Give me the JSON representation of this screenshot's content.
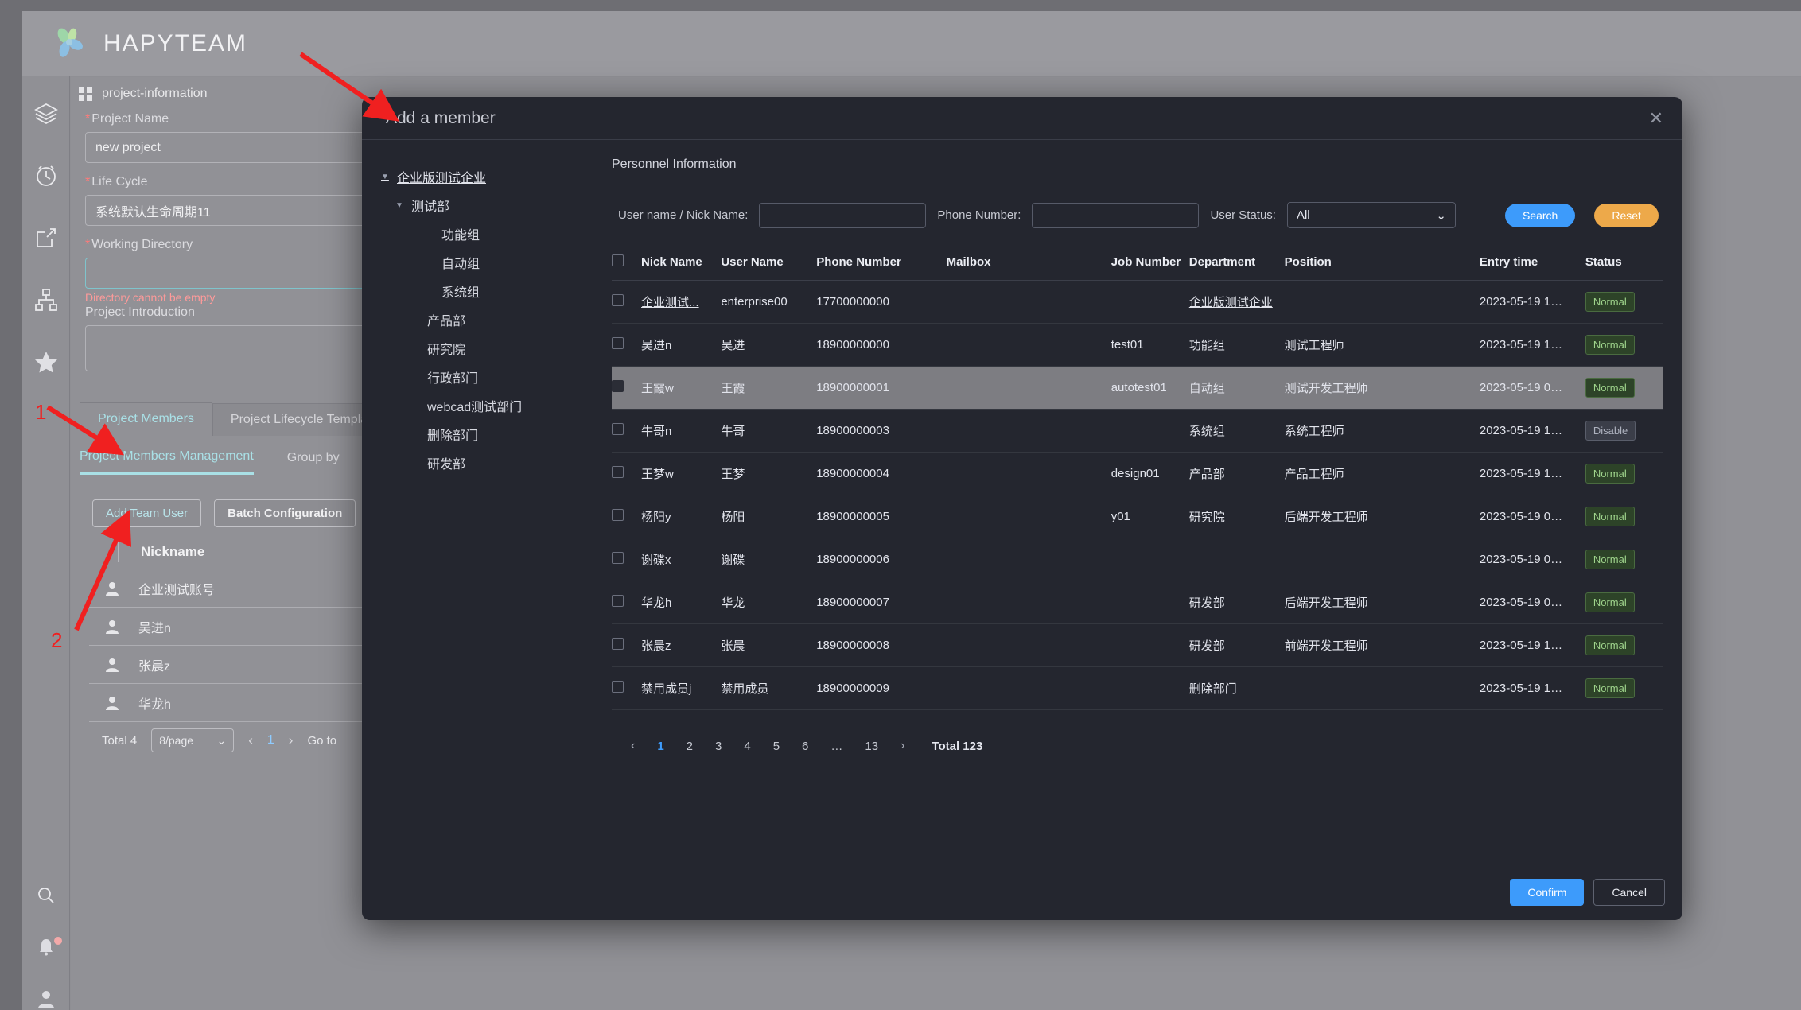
{
  "brand": {
    "title": "HAPYTEAM",
    "logo_icon": "flower-logo-icon"
  },
  "rail": {
    "items": [
      {
        "icon": "layers-icon",
        "name": "rail-item-layers"
      },
      {
        "icon": "clock-icon",
        "name": "rail-item-clock"
      },
      {
        "icon": "share-icon",
        "name": "rail-item-share"
      },
      {
        "icon": "org-chart-icon",
        "name": "rail-item-org"
      },
      {
        "icon": "star-icon",
        "name": "rail-item-star"
      }
    ],
    "bottom": [
      {
        "icon": "search-icon",
        "name": "rail-item-search"
      },
      {
        "icon": "bell-icon",
        "name": "rail-item-notifications"
      },
      {
        "icon": "user-icon",
        "name": "rail-item-account"
      }
    ]
  },
  "breadcrumb": {
    "icon": "grid-icon",
    "text": "project-information"
  },
  "form": {
    "project_name": {
      "label": "Project Name",
      "required": "*",
      "value": "new project"
    },
    "life_cycle": {
      "label": "Life Cycle",
      "required": "*",
      "value": "系统默认生命周期11"
    },
    "working_directory": {
      "label": "Working Directory",
      "required": "*",
      "value": "",
      "error": "Directory cannot be empty"
    },
    "project_introduction": {
      "label": "Project Introduction",
      "value": ""
    }
  },
  "tabs": [
    {
      "label": "Project Members",
      "active": true
    },
    {
      "label": "Project Lifecycle Template Settin",
      "active": false
    }
  ],
  "subtabs": [
    {
      "label": "Project Members Management",
      "active": true
    },
    {
      "label": "Group by",
      "active": false
    }
  ],
  "actions": {
    "add_team_user": "Add Team User",
    "batch_configuration": "Batch Configuration"
  },
  "members_table": {
    "header": "Nickname",
    "rows": [
      {
        "name": "企业测试账号"
      },
      {
        "name": "吴进n"
      },
      {
        "name": "张晨z"
      },
      {
        "name": "华龙h"
      }
    ],
    "pager": {
      "total": "Total 4",
      "page_size": "8/page",
      "prev": "‹",
      "current": "1",
      "next": "›",
      "goto": "Go to"
    }
  },
  "modal": {
    "title": "Add a member",
    "close_icon": "close-icon",
    "tree": [
      {
        "label": "企业版测试企业",
        "level": 0,
        "caret": "▼",
        "underline": true
      },
      {
        "label": "测试部",
        "level": 1,
        "caret": "▼",
        "underline": false
      },
      {
        "label": "功能组",
        "level": 2,
        "caret": "",
        "underline": false
      },
      {
        "label": "自动组",
        "level": 2,
        "caret": "",
        "underline": false
      },
      {
        "label": "系统组",
        "level": 2,
        "caret": "",
        "underline": false
      },
      {
        "label": "产品部",
        "level": 1,
        "caret": "",
        "underline": false
      },
      {
        "label": "研究院",
        "level": 1,
        "caret": "",
        "underline": false
      },
      {
        "label": "行政部门",
        "level": 1,
        "caret": "",
        "underline": false
      },
      {
        "label": "webcad测试部门",
        "level": 1,
        "caret": "",
        "underline": false
      },
      {
        "label": "删除部门",
        "level": 1,
        "caret": "",
        "underline": false
      },
      {
        "label": "研发部",
        "level": 1,
        "caret": "",
        "underline": false
      }
    ],
    "panel_title": "Personnel Information",
    "filters": {
      "username_label": "User name / Nick Name:",
      "username_value": "",
      "phone_label": "Phone Number:",
      "phone_value": "",
      "status_label": "User Status:",
      "status_value": "All",
      "chevron_icon": "chevron-down-icon",
      "search_button": "Search",
      "reset_button": "Reset"
    },
    "table": {
      "columns": [
        "",
        "Nick Name",
        "User Name",
        "Phone Number",
        "Mailbox",
        "Job Number",
        "Department",
        "Position",
        "Entry time",
        "Status"
      ],
      "rows": [
        {
          "checked": false,
          "selected": false,
          "nick": "企业测试...",
          "nick_link": true,
          "user": "enterprise00",
          "phone": "17700000000",
          "mailbox": "",
          "job": "",
          "dept": "企业版测试企业",
          "dept_link": true,
          "position": "",
          "entry": "2023-05-19 1…",
          "status": "Normal",
          "status_kind": "normal"
        },
        {
          "checked": false,
          "selected": false,
          "nick": "吴进n",
          "nick_link": false,
          "user": "吴进",
          "phone": "18900000000",
          "mailbox": "",
          "job": "test01",
          "dept": "功能组",
          "dept_link": false,
          "position": "测试工程师",
          "entry": "2023-05-19 1…",
          "status": "Normal",
          "status_kind": "normal"
        },
        {
          "checked": true,
          "selected": true,
          "nick": "王霞w",
          "nick_link": false,
          "user": "王霞",
          "phone": "18900000001",
          "mailbox": "",
          "job": "autotest01",
          "dept": "自动组",
          "dept_link": false,
          "position": "测试开发工程师",
          "entry": "2023-05-19 0…",
          "status": "Normal",
          "status_kind": "normal"
        },
        {
          "checked": false,
          "selected": false,
          "nick": "牛哥n",
          "nick_link": false,
          "user": "牛哥",
          "phone": "18900000003",
          "mailbox": "",
          "job": "",
          "dept": "系统组",
          "dept_link": false,
          "position": "系统工程师",
          "entry": "2023-05-19 1…",
          "status": "Disable",
          "status_kind": "disable"
        },
        {
          "checked": false,
          "selected": false,
          "nick": "王梦w",
          "nick_link": false,
          "user": "王梦",
          "phone": "18900000004",
          "mailbox": "",
          "job": "design01",
          "dept": "产品部",
          "dept_link": false,
          "position": "产品工程师",
          "entry": "2023-05-19 1…",
          "status": "Normal",
          "status_kind": "normal"
        },
        {
          "checked": false,
          "selected": false,
          "nick": "杨阳y",
          "nick_link": false,
          "user": "杨阳",
          "phone": "18900000005",
          "mailbox": "",
          "job": "y01",
          "dept": "研究院",
          "dept_link": false,
          "position": "后端开发工程师",
          "entry": "2023-05-19 0…",
          "status": "Normal",
          "status_kind": "normal"
        },
        {
          "checked": false,
          "selected": false,
          "nick": "谢碟x",
          "nick_link": false,
          "user": "谢碟",
          "phone": "18900000006",
          "mailbox": "",
          "job": "",
          "dept": "",
          "dept_link": false,
          "position": "",
          "entry": "2023-05-19 0…",
          "status": "Normal",
          "status_kind": "normal"
        },
        {
          "checked": false,
          "selected": false,
          "nick": "华龙h",
          "nick_link": false,
          "user": "华龙",
          "phone": "18900000007",
          "mailbox": "",
          "job": "",
          "dept": "研发部",
          "dept_link": false,
          "position": "后端开发工程师",
          "entry": "2023-05-19 0…",
          "status": "Normal",
          "status_kind": "normal"
        },
        {
          "checked": false,
          "selected": false,
          "nick": "张晨z",
          "nick_link": false,
          "user": "张晨",
          "phone": "18900000008",
          "mailbox": "",
          "job": "",
          "dept": "研发部",
          "dept_link": false,
          "position": "前端开发工程师",
          "entry": "2023-05-19 1…",
          "status": "Normal",
          "status_kind": "normal"
        },
        {
          "checked": false,
          "selected": false,
          "nick": "禁用成员j",
          "nick_link": false,
          "user": "禁用成员",
          "phone": "18900000009",
          "mailbox": "",
          "job": "",
          "dept": "删除部门",
          "dept_link": false,
          "position": "",
          "entry": "2023-05-19 1…",
          "status": "Normal",
          "status_kind": "normal"
        }
      ]
    },
    "pagination": {
      "prev": "‹",
      "pages": [
        "1",
        "2",
        "3",
        "4",
        "5",
        "6",
        "…",
        "13"
      ],
      "current": "1",
      "next": "›",
      "total": "Total 123"
    },
    "footer": {
      "confirm": "Confirm",
      "cancel": "Cancel"
    }
  },
  "annotations": [
    {
      "label": "1",
      "name": "annotation-marker-1"
    },
    {
      "label": "2",
      "name": "annotation-marker-2"
    }
  ],
  "colors": {
    "accent_blue": "#3d9bfb",
    "accent_orange": "#eda94a",
    "modal_bg": "#24262f",
    "page_bg": "#919196",
    "badge_normal": "#9fd48c",
    "annotation_red": "#f02020",
    "teal": "#a9e0e6"
  }
}
